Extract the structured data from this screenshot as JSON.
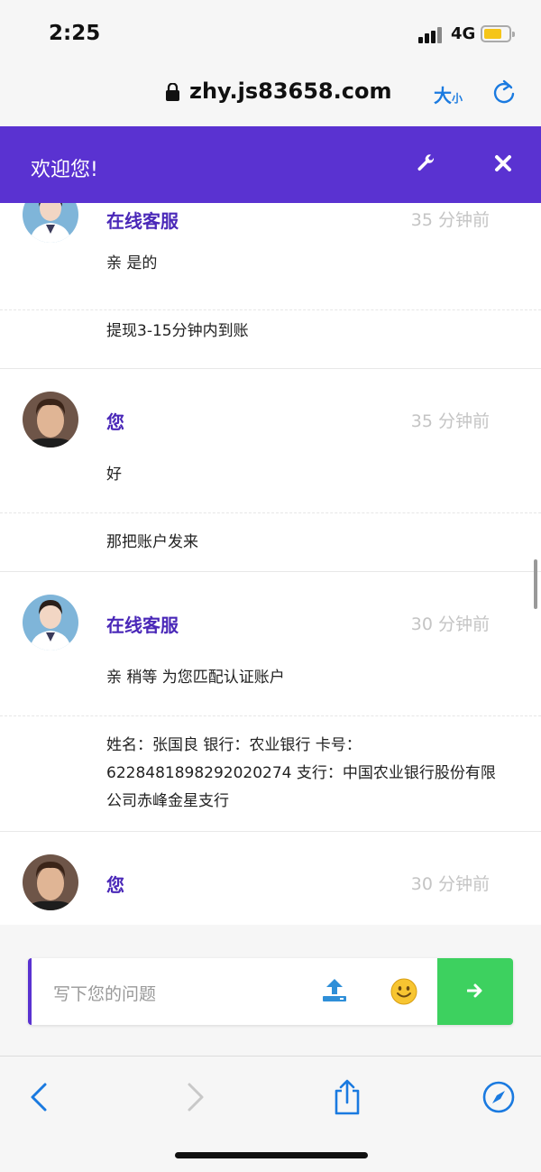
{
  "status_bar": {
    "time": "2:25",
    "network": "4G"
  },
  "browser": {
    "url": "zhy.js83658.com",
    "text_size_big": "大",
    "text_size_small": "小"
  },
  "chat_header": {
    "title": "欢迎您!"
  },
  "messages": [
    {
      "sender": "在线客服",
      "time": "35 分钟前",
      "lines": [
        "亲 是的",
        "提现3-15分钟内到账"
      ]
    },
    {
      "sender": "您",
      "time": "35 分钟前",
      "lines": [
        "好",
        "那把账户发来"
      ]
    },
    {
      "sender": "在线客服",
      "time": "30 分钟前",
      "lines": [
        "亲 稍等 为您匹配认证账户",
        "姓名：张国良 银行：农业银行 卡号：6228481898292020274 支行：中国农业银行股份有限公司赤峰金星支行"
      ]
    },
    {
      "sender": "您",
      "time": "30 分钟前",
      "lines": []
    }
  ],
  "composer": {
    "placeholder": "写下您的问题"
  },
  "colors": {
    "header": "#5a32d1",
    "send": "#3dd15f",
    "link": "#1a7ae0"
  }
}
